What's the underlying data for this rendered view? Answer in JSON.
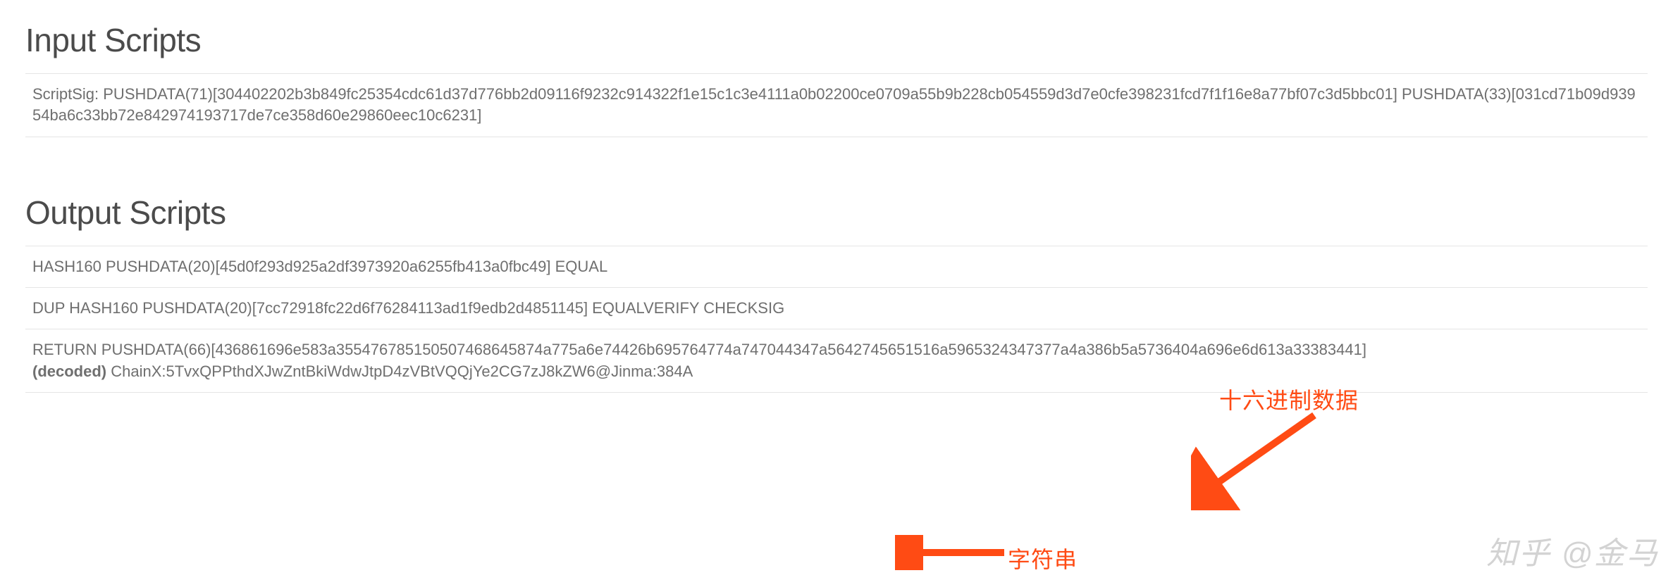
{
  "input": {
    "heading": "Input Scripts",
    "rows": [
      {
        "lines": [
          "ScriptSig: PUSHDATA(71)[304402202b3b849fc25354cdc61d37d776bb2d09116f9232c914322f1e15c1c3e4111a0b02200ce0709a55b9b228cb054559d3d7e0cfe398231fcd7f1f16e8a77bf07c3d5bbc01] PUSHDATA(33)[031cd71b09d93954ba6c33bb72e842974193717de7ce358d60e29860eec10c6231]"
        ]
      }
    ]
  },
  "output": {
    "heading": "Output Scripts",
    "rows": [
      {
        "lines": [
          "HASH160 PUSHDATA(20)[45d0f293d925a2df3973920a6255fb413a0fbc49] EQUAL"
        ]
      },
      {
        "lines": [
          "DUP HASH160 PUSHDATA(20)[7cc72918fc22d6f76284113ad1f9edb2d4851145] EQUALVERIFY CHECKSIG"
        ]
      },
      {
        "lines": [
          "RETURN PUSHDATA(66)[436861696e583a355476785150507468645874a775a6e74426b695764774a747044347a5642745651516a5965324347377a4a386b5a5736404a696e6d613a33383441]"
        ],
        "decoded_label": "(decoded)",
        "decoded_value": " ChainX:5TvxQPPthdXJwZntBkiWdwJtpD4zVBtVQQjYe2CG7zJ8kZW6@Jinma:384A"
      }
    ]
  },
  "annotations": {
    "hex_label": "十六进制数据",
    "string_label": "字符串"
  },
  "watermark": "知乎 @金马"
}
